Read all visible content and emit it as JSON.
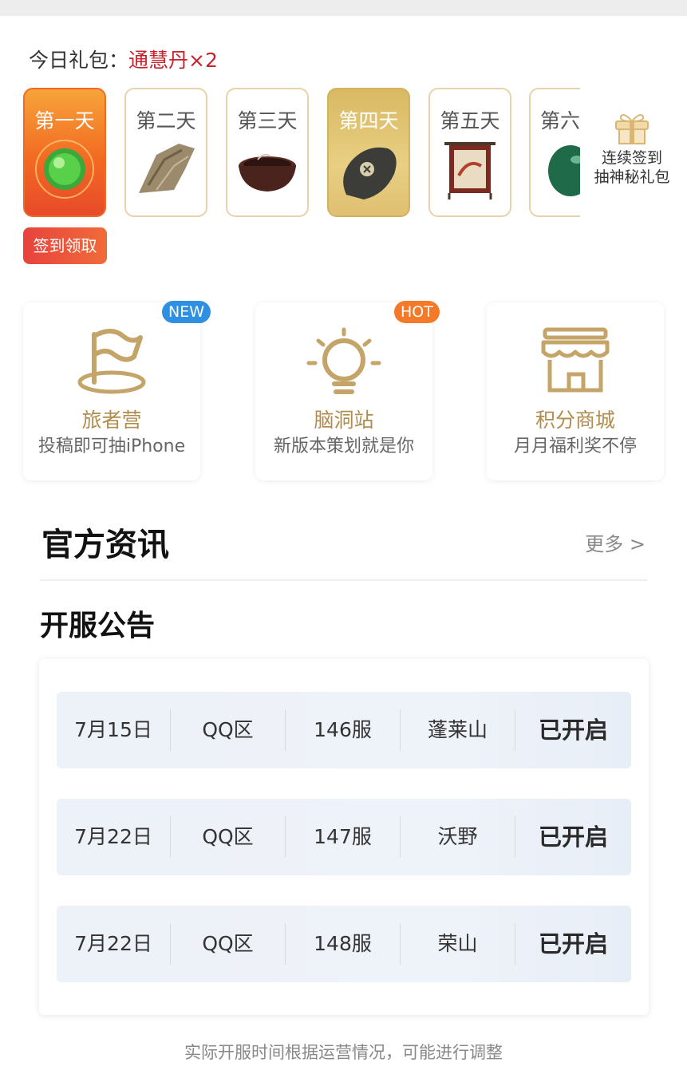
{
  "daily_gift": {
    "label": "今日礼包：",
    "value": "通慧丹×2",
    "days": [
      {
        "name": "第一天",
        "state": "active",
        "icon": "jade-orb-icon"
      },
      {
        "name": "第二天",
        "state": "normal",
        "icon": "dried-leaf-icon"
      },
      {
        "name": "第三天",
        "state": "normal",
        "icon": "bowl-icon"
      },
      {
        "name": "第四天",
        "state": "gold",
        "icon": "stone-token-icon"
      },
      {
        "name": "第五天",
        "state": "normal",
        "icon": "banner-icon"
      },
      {
        "name": "第六",
        "state": "normal",
        "icon": "green-stone-icon"
      }
    ],
    "mystery_line1": "连续签到",
    "mystery_line2": "抽神秘礼包",
    "sign_button": "签到领取"
  },
  "features": [
    {
      "title": "旅者营",
      "subtitle": "投稿即可抽iPhone",
      "badge": "NEW",
      "icon": "flag-icon"
    },
    {
      "title": "脑洞站",
      "subtitle": "新版本策划就是你",
      "badge": "HOT",
      "icon": "lightbulb-icon"
    },
    {
      "title": "积分商城",
      "subtitle": "月月福利奖不停",
      "badge": "",
      "icon": "shop-icon"
    }
  ],
  "news": {
    "title": "官方资讯",
    "more": "更多 >"
  },
  "server_notice": {
    "title": "开服公告",
    "rows": [
      {
        "date": "7月15日",
        "zone": "QQ区",
        "server": "146服",
        "name": "蓬莱山",
        "status": "已开启"
      },
      {
        "date": "7月22日",
        "zone": "QQ区",
        "server": "147服",
        "name": "沃野",
        "status": "已开启"
      },
      {
        "date": "7月22日",
        "zone": "QQ区",
        "server": "148服",
        "name": "荣山",
        "status": "已开启"
      }
    ],
    "footnote": "实际开服时间根据运营情况，可能进行调整"
  },
  "colors": {
    "accent_red": "#c8232c",
    "gold_text": "#b08d4e",
    "active_orange": "#f26a22"
  }
}
